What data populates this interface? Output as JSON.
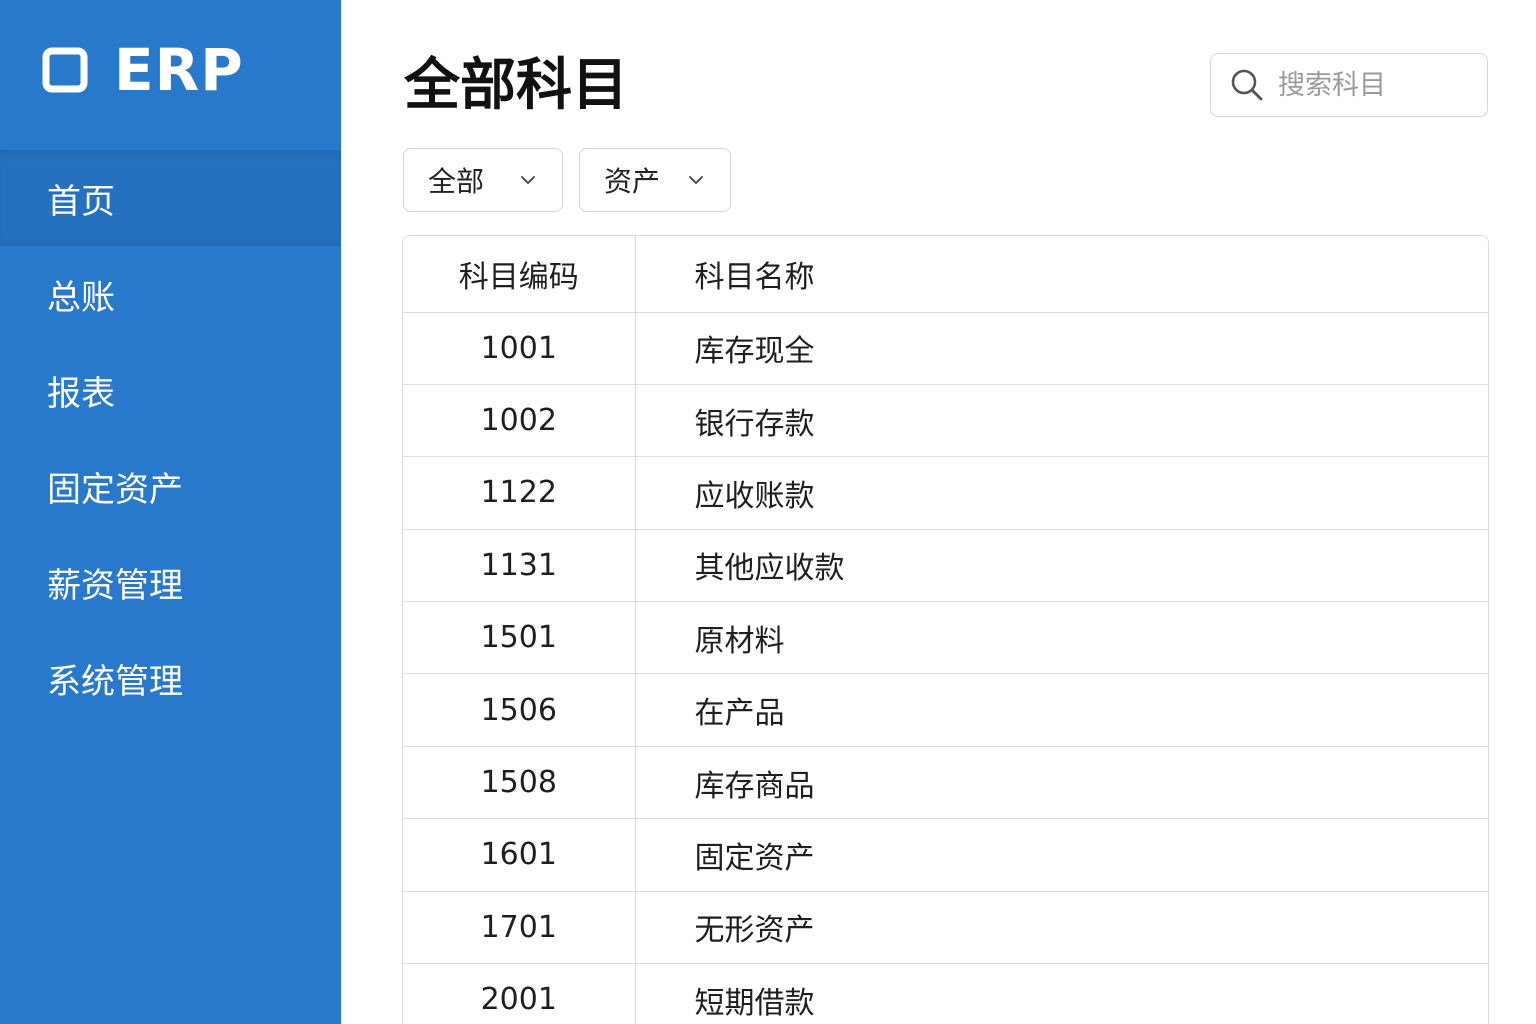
{
  "brand": {
    "name": "ERP",
    "icon": "square-logo-icon"
  },
  "sidebar": {
    "items": [
      {
        "label": "首页",
        "active": true
      },
      {
        "label": "总账",
        "active": false
      },
      {
        "label": "报表",
        "active": false
      },
      {
        "label": "固定资产",
        "active": false
      },
      {
        "label": "薪资管理",
        "active": false
      },
      {
        "label": "系统管理",
        "active": false
      }
    ]
  },
  "header": {
    "title": "全部科目"
  },
  "search": {
    "placeholder": "搜索科目",
    "icon": "search-icon"
  },
  "filters": [
    {
      "value": "全部",
      "icon": "chevron-down-icon"
    },
    {
      "value": "资产",
      "icon": "chevron-down-icon"
    }
  ],
  "table": {
    "columns": [
      "科目编码",
      "科目名称"
    ],
    "rows": [
      {
        "code": "1001",
        "name": "库存现全"
      },
      {
        "code": "1002",
        "name": "银行存款"
      },
      {
        "code": "1122",
        "name": "应收账款"
      },
      {
        "code": "1131",
        "name": "其他应收款"
      },
      {
        "code": "1501",
        "name": "原材料"
      },
      {
        "code": "1506",
        "name": "在产品"
      },
      {
        "code": "1508",
        "name": "库存商品"
      },
      {
        "code": "1601",
        "name": "固定资产"
      },
      {
        "code": "1701",
        "name": "无形资产"
      },
      {
        "code": "2001",
        "name": "短期借款"
      }
    ]
  },
  "colors": {
    "sidebar_bg": "#2878cc",
    "sidebar_active_bg": "#2670c0",
    "border": "#dcdcdc",
    "text": "#1f1f1f"
  }
}
